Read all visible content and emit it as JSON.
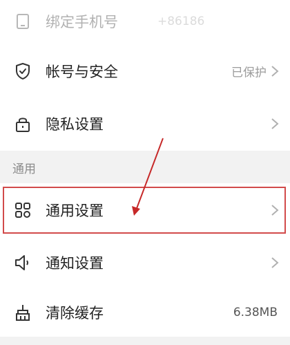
{
  "settings": {
    "account_rows": [
      {
        "label": "绑定手机号",
        "value": "+86186",
        "icon": "phone-icon",
        "faded": true
      },
      {
        "label": "帐号与安全",
        "value": "已保护",
        "icon": "shield-icon"
      },
      {
        "label": "隐私设置",
        "value": "",
        "icon": "lock-icon"
      }
    ],
    "section_general": "通用",
    "general_rows": [
      {
        "label": "通用设置",
        "value": "",
        "icon": "grid-icon"
      },
      {
        "label": "通知设置",
        "value": "",
        "icon": "speaker-icon"
      },
      {
        "label": "清除缓存",
        "value": "6.38MB",
        "icon": "broom-icon"
      }
    ]
  },
  "colors": {
    "highlight": "#d24a4a",
    "arrow": "#c62828",
    "text": "#222222",
    "secondary": "#9b9b9b"
  }
}
